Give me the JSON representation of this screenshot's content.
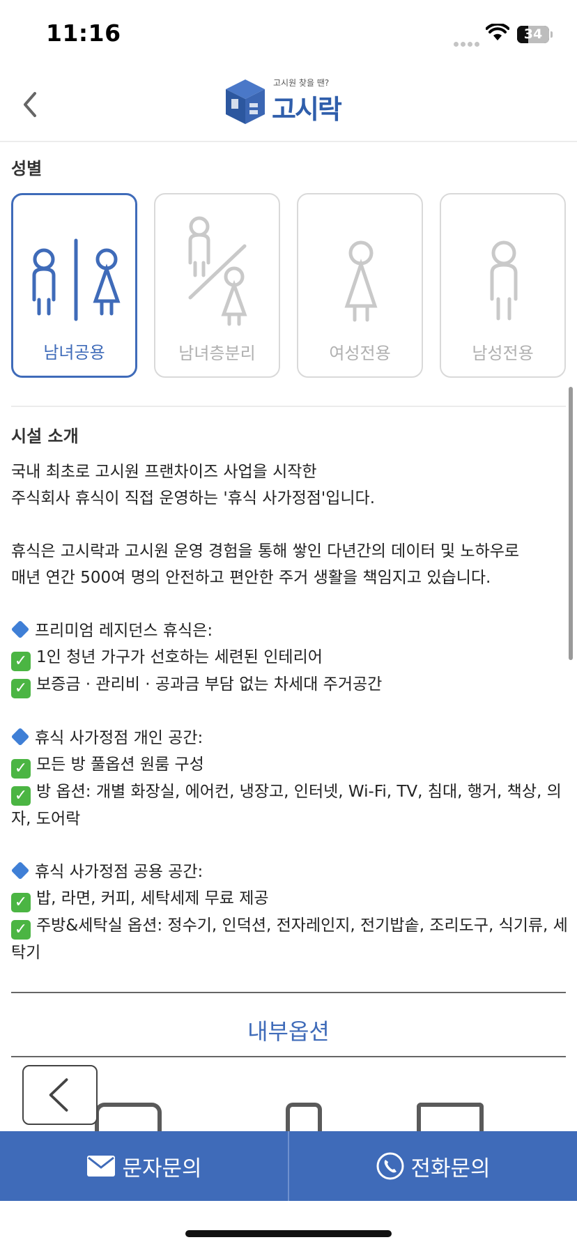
{
  "status_bar": {
    "time": "11:16",
    "battery_percent": "34",
    "battery_level": 0.34
  },
  "header": {
    "logo_subtitle": "고시원 찾을 땐?",
    "logo_title": "고시락"
  },
  "gender": {
    "title": "성별",
    "options": [
      {
        "label": "남녀공용",
        "selected": true
      },
      {
        "label": "남녀층분리",
        "selected": false
      },
      {
        "label": "여성전용",
        "selected": false
      },
      {
        "label": "남성전용",
        "selected": false
      }
    ]
  },
  "facility": {
    "title": "시설 소개",
    "lines": [
      "국내 최초로 고시원 프랜차이즈 사업을 시작한",
      "주식회사 휴식이 직접 운영하는 '휴식 사가정점'입니다.",
      "",
      "휴식은 고시락과 고시원 운영 경험을 통해 쌓인 다년간의 데이터 및 노하우로",
      "매년 연간 500여 명의 안전하고 편안한 주거 생활을 책임지고 있습니다.",
      "",
      "프리미엄 레지던스 휴식은:",
      "1인 청년 가구가 선호하는 세련된 인테리어",
      "보증금 · 관리비 · 공과금 부담 없는 차세대 주거공간",
      "",
      "휴식 사가정점 개인 공간:",
      "모든 방 풀옵션 원룸 구성",
      "방 옵션: 개별 화장실, 에어컨, 냉장고, 인터넷, Wi-Fi, TV, 침대, 행거, 책상, 의자, 도어락",
      "",
      "휴식 사가정점 공용 공간:",
      "밥, 라면, 커피, 세탁세제 무료 제공",
      "주방&세탁실 옵션: 정수기, 인덕션, 전자레인지, 전기밥솥, 조리도구, 식기류, 세탁기"
    ]
  },
  "options_section": {
    "title": "내부옵션"
  },
  "bottom_bar": {
    "sms_label": "문자문의",
    "call_label": "전화문의"
  },
  "icons": {
    "back": "chevron-left-icon",
    "sms": "envelope-icon",
    "call": "phone-icon",
    "diamond": "blue-diamond-icon",
    "check": "check-box-icon"
  },
  "colors": {
    "accent": "#3f6bb9",
    "bottom_bar": "#3f6bb9",
    "inactive": "#c4c4c4",
    "check": "#4bb543",
    "diamond": "#3f7fd6"
  }
}
